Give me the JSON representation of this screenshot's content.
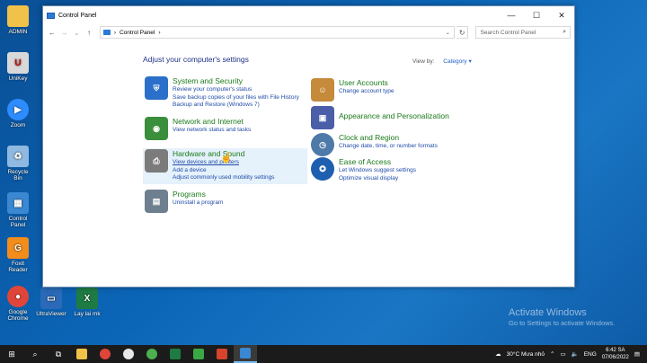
{
  "desktop": {
    "icons": [
      {
        "label": "ADMIN",
        "color": "#f0c24a"
      },
      {
        "label": "UniKey",
        "color": "#d9d9d9"
      },
      {
        "label": "Zoom",
        "color": "#2d8cff"
      },
      {
        "label": "Recycle Bin",
        "color": "#8fb9e0"
      },
      {
        "label": "Control Panel",
        "color": "#3a88d2"
      },
      {
        "label": "Foxit Reader",
        "color": "#f28c1a"
      },
      {
        "label": "Google Chrome",
        "color": "#e0453a"
      },
      {
        "label": "UltraViewer",
        "color": "#2a6ab8"
      },
      {
        "label": "Lay lai mk",
        "color": "#1e7b43"
      }
    ],
    "watermark": {
      "title": "Activate Windows",
      "subtitle": "Go to Settings to activate Windows."
    }
  },
  "window": {
    "title": "Control Panel",
    "controls": {
      "minimize": "—",
      "maximize": "☐",
      "close": "✕"
    },
    "nav": {
      "back": "←",
      "forward": "→",
      "recent": "⌄",
      "up": "↑",
      "refresh": "↻"
    },
    "breadcrumb": "Control Panel",
    "breadcrumb_sep": "›",
    "search_placeholder": "Search Control Panel",
    "heading": "Adjust your computer's settings",
    "view_by_label": "View by:",
    "view_by_value": "Category ▾"
  },
  "categories_left": [
    {
      "title": "System and Security",
      "icon": "shield-icon",
      "color": "#2a6fc9",
      "links": [
        "Review your computer's status",
        "Save backup copies of your files with File History",
        "Backup and Restore (Windows 7)"
      ]
    },
    {
      "title": "Network and Internet",
      "icon": "network-icon",
      "color": "#3b8e3b",
      "links": [
        "View network status and tasks"
      ]
    },
    {
      "title": "Hardware and Sound",
      "icon": "printer-icon",
      "color": "#7b7b7b",
      "links": [
        "View devices and printers",
        "Add a device",
        "Adjust commonly used mobility settings"
      ]
    },
    {
      "title": "Programs",
      "icon": "programs-icon",
      "color": "#6e7f8f",
      "links": [
        "Uninstall a program"
      ]
    }
  ],
  "categories_right": [
    {
      "title": "User Accounts",
      "icon": "users-icon",
      "color": "#c58a3a",
      "links": [
        "Change account type"
      ]
    },
    {
      "title": "Appearance and Personalization",
      "icon": "appearance-icon",
      "color": "#4a5fa8",
      "links": []
    },
    {
      "title": "Clock and Region",
      "icon": "clock-icon",
      "color": "#4d7aa8",
      "links": [
        "Change date, time, or number formats"
      ]
    },
    {
      "title": "Ease of Access",
      "icon": "ease-of-access-icon",
      "color": "#1f5fb0",
      "links": [
        "Let Windows suggest settings",
        "Optimize visual display"
      ]
    }
  ],
  "taskbar": {
    "start": "⊞",
    "search": "⌕",
    "weather": "30°C  Mưa nhỏ",
    "language": "ENG",
    "time": "6:42 SA",
    "date": "07/06/2022"
  }
}
